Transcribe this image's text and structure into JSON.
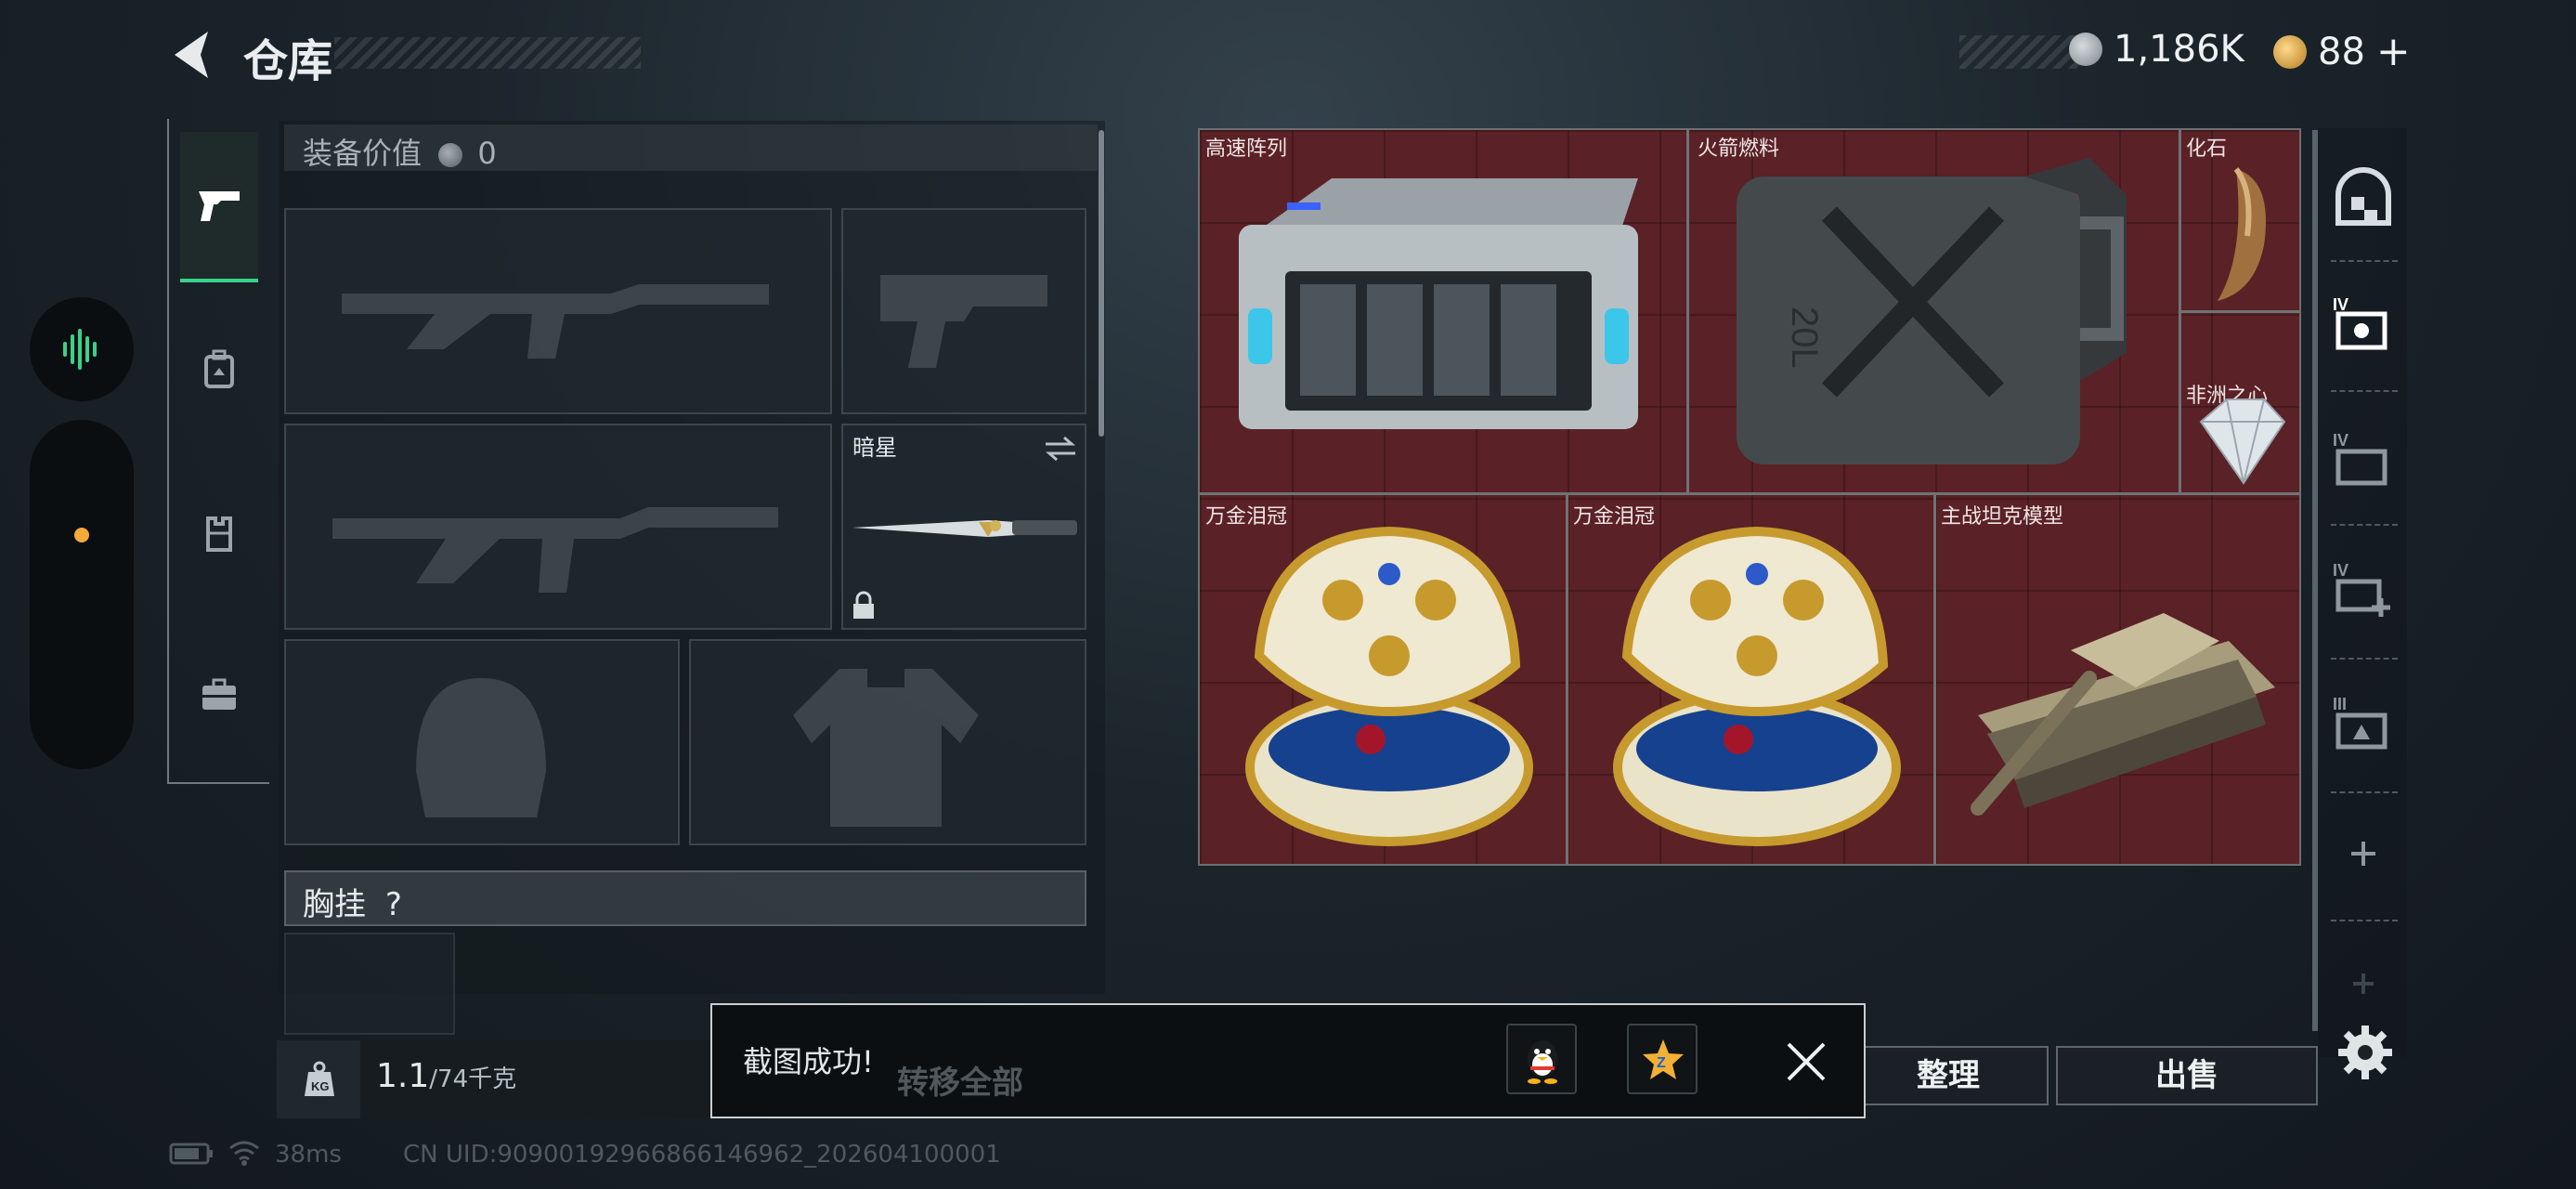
{
  "header": {
    "title": "仓库",
    "currency_silver": "1,186K",
    "currency_gold": "88",
    "add_symbol": "+"
  },
  "equipment": {
    "value_label": "装备价值",
    "value": "0",
    "melee_name": "暗星",
    "chest_rig_label": "胸挂",
    "chest_rig_help": "?"
  },
  "stash": {
    "items": [
      {
        "name": "高速阵列",
        "icon": "server-array-icon"
      },
      {
        "name": "火箭燃料",
        "icon": "fuel-canister-icon"
      },
      {
        "name": "化石",
        "icon": "fossil-claw-icon"
      },
      {
        "name": "非洲之心",
        "icon": "diamond-icon"
      },
      {
        "name": "万金泪冠",
        "icon": "jeweled-egg-icon"
      },
      {
        "name": "万金泪冠",
        "icon": "jeweled-egg-icon"
      },
      {
        "name": "主战坦克模型",
        "icon": "tank-model-icon"
      }
    ],
    "fuel_can_text": "20L"
  },
  "bottom": {
    "weight_current": "1.1",
    "weight_max": "/74千克",
    "weight_badge": "KG",
    "transfer_all": "转移全部",
    "sort": "整理",
    "sell": "出售"
  },
  "toast": {
    "message": "截图成功!"
  },
  "status": {
    "ping": "38ms",
    "uid": "CN UID:9090019296686614​6962_202604100001"
  },
  "colors": {
    "accent_green": "#39d28a",
    "stash_red": "#5a2126",
    "gold": "#f2b134"
  }
}
